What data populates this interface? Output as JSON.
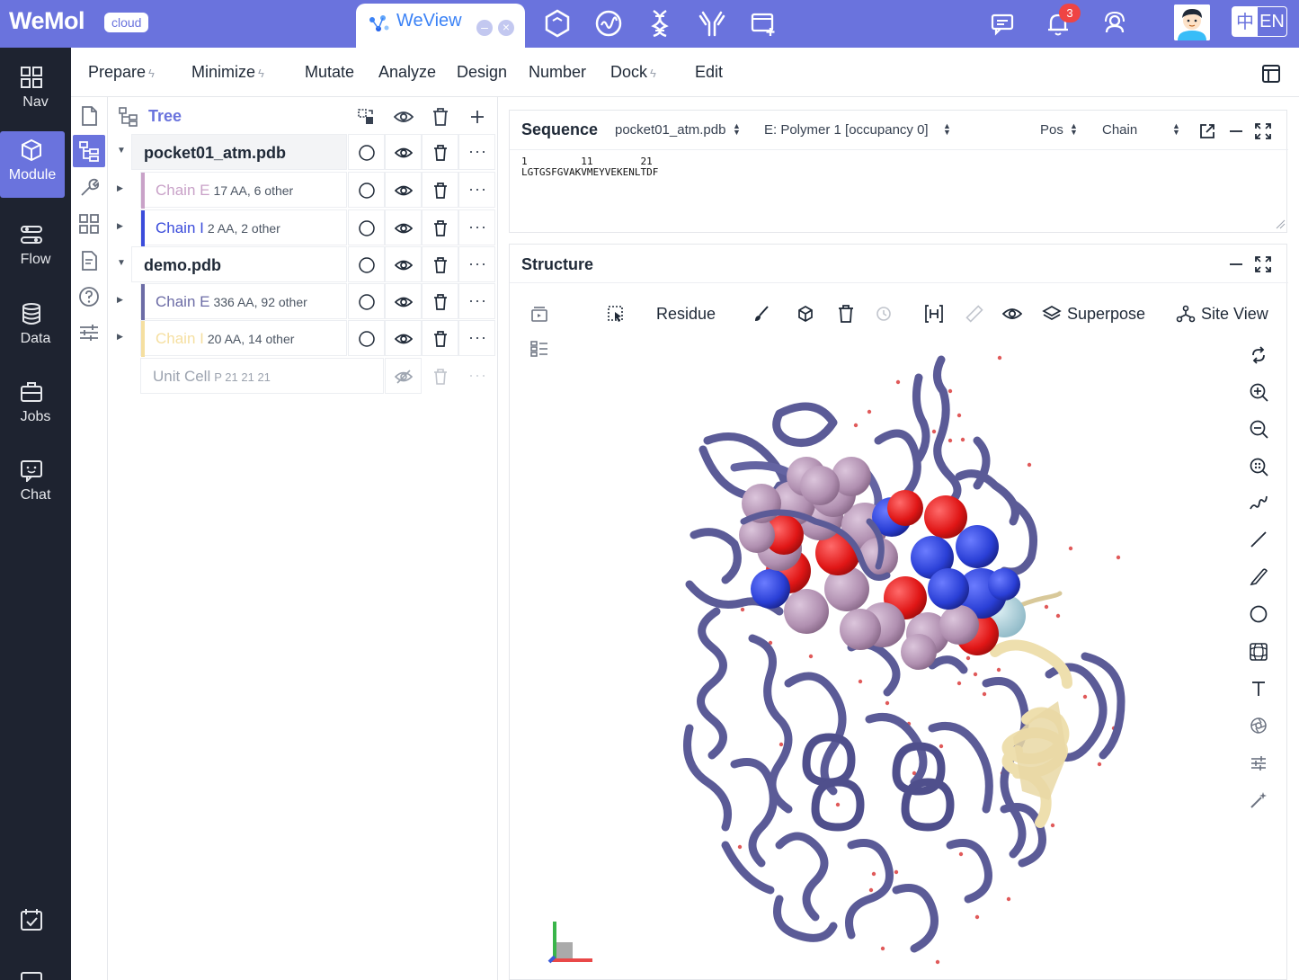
{
  "app": {
    "logo": "WeMol",
    "badge": "cloud",
    "active_tab": "WeView",
    "notification_count": "3",
    "lang_zh": "中",
    "lang_en": "EN"
  },
  "sidebar": {
    "items": [
      {
        "label": "Nav",
        "icon": "grid-icon"
      },
      {
        "label": "Module",
        "icon": "cube-icon",
        "active": true
      },
      {
        "label": "Flow",
        "icon": "flow-icon"
      },
      {
        "label": "Data",
        "icon": "database-icon"
      },
      {
        "label": "Jobs",
        "icon": "briefcase-icon"
      },
      {
        "label": "Chat",
        "icon": "chat-icon"
      }
    ]
  },
  "menu": {
    "prepare": "Prepare",
    "minimize": "Minimize",
    "mutate": "Mutate",
    "analyze": "Analyze",
    "design": "Design",
    "number": "Number",
    "dock": "Dock",
    "edit": "Edit",
    "bolt": "ϟ"
  },
  "tree": {
    "title": "Tree",
    "rows": [
      {
        "type": "file",
        "name": "pocket01_atm.pdb",
        "meta": ""
      },
      {
        "type": "chain",
        "name": "Chain E",
        "meta": "17 AA, 6 other",
        "color": "#c9a2c8"
      },
      {
        "type": "chain",
        "name": "Chain I",
        "meta": "2 AA, 2 other",
        "color": "#3b4cdb"
      },
      {
        "type": "file",
        "name": "demo.pdb",
        "meta": ""
      },
      {
        "type": "chain",
        "name": "Chain E",
        "meta": "336 AA, 92 other",
        "color": "#6c6ca6"
      },
      {
        "type": "chain",
        "name": "Chain I",
        "meta": "20 AA, 14 other",
        "color": "#f5dfa0"
      },
      {
        "type": "unit",
        "name": "Unit Cell",
        "meta": "P 21 21 21"
      }
    ]
  },
  "sequence": {
    "title": "Sequence",
    "file_select": "pocket01_atm.pdb",
    "polymer_select": "E: Polymer 1 [occupancy 0]",
    "pos_select": "Pos",
    "chain_select": "Chain",
    "ruler": "1         11        21",
    "residues": "LGTGSFGVAKVMEYVEKENLTDF"
  },
  "structure": {
    "title": "Structure",
    "residue_label": "Residue",
    "superpose_label": "Superpose",
    "siteview_label": "Site View"
  },
  "colors": {
    "brand": "#6a73dd",
    "sidebar_bg": "#1e2330",
    "protein": "#5a5a96",
    "ligand_carbon": "#b89ab8",
    "oxygen": "#e11d1d",
    "nitrogen": "#2a3fd6",
    "helix_chain_i": "#eedfae"
  }
}
